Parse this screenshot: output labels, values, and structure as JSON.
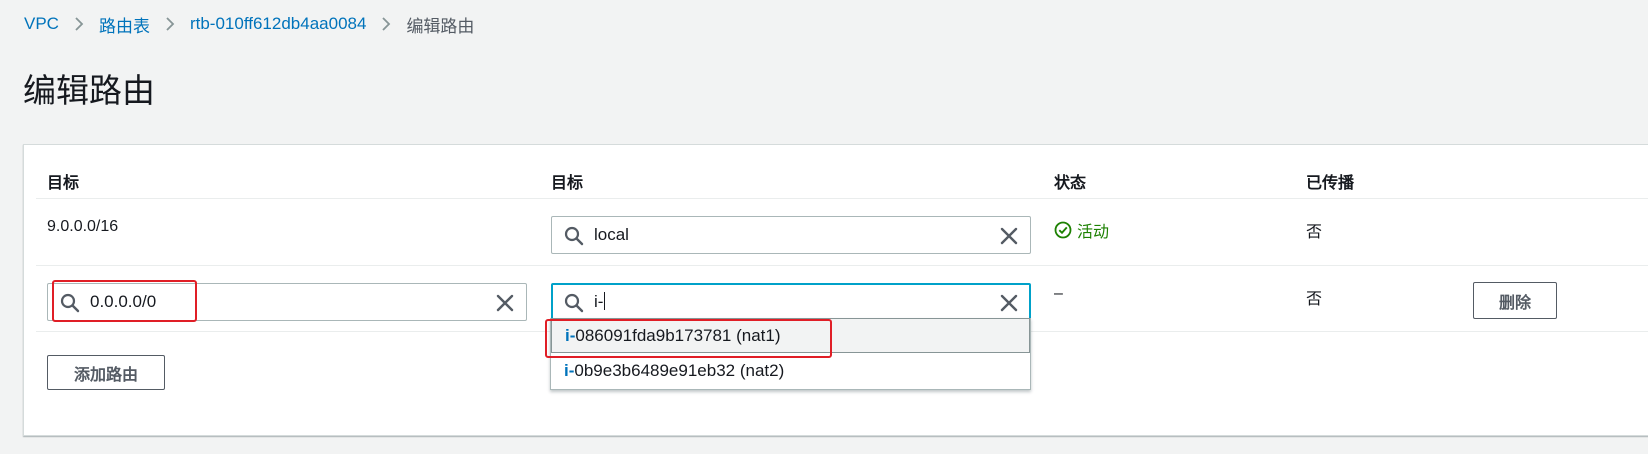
{
  "breadcrumb": {
    "items": [
      "VPC",
      "路由表",
      "rtb-010ff612db4aa0084"
    ],
    "current": "编辑路由"
  },
  "page_title": "编辑路由",
  "table": {
    "headers": [
      "目标",
      "目标",
      "状态",
      "已传播"
    ],
    "rows": [
      {
        "destination": "9.0.0.0/16",
        "target_value": "local",
        "status": "活动",
        "propagated": "否"
      },
      {
        "destination_value": "0.0.0.0/0",
        "target_value": "i-",
        "status": "–",
        "propagated": "否",
        "remove_label": "删除"
      }
    ]
  },
  "add_route_label": "添加路由",
  "dropdown": {
    "options": [
      {
        "match": "i-",
        "rest": "086091fda9b173781 (nat1)"
      },
      {
        "match": "i-",
        "rest": "0b9e3b6489e91eb32 (nat2)"
      }
    ]
  },
  "colors": {
    "link": "#0073bb",
    "success": "#1d8102",
    "focus": "#00a1c9",
    "highlight": "#e01e26"
  }
}
